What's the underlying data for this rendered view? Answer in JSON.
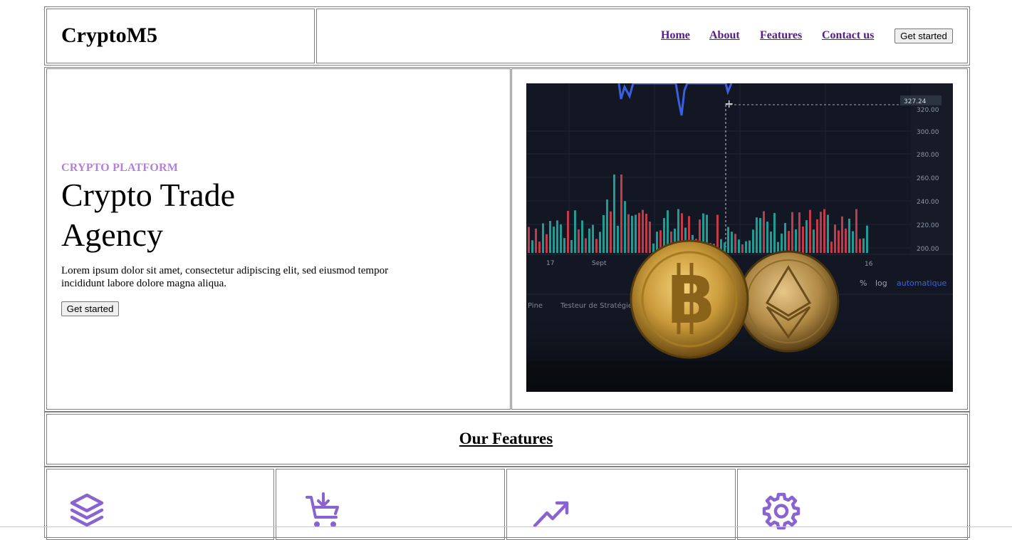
{
  "header": {
    "brand": "CryptoM5",
    "nav": [
      {
        "label": "Home"
      },
      {
        "label": "About"
      },
      {
        "label": "Features"
      },
      {
        "label": "Contact us"
      }
    ],
    "cta_label": "Get started"
  },
  "hero": {
    "eyebrow": "CRYPTO PLATFORM",
    "title": "Crypto Trade Agency",
    "description": "Lorem ipsum dolor sit amet, consectetur adipiscing elit, sed eiusmod tempor incididunt labore dolore magna aliqua.",
    "cta_label": "Get started",
    "image": {
      "price_ticks": [
        "320.00",
        "300.00",
        "280.00",
        "260.00",
        "240.00",
        "220.00",
        "200.00"
      ],
      "price_marker": "327.24",
      "date_labels": [
        "17",
        "Sept",
        "16"
      ],
      "controls": [
        "%",
        "log",
        "automatique"
      ],
      "panel_tabs": [
        "Pine",
        "Testeur de Stratégie"
      ]
    }
  },
  "features": {
    "title": "Our Features",
    "items": [
      {
        "icon": "layers-icon"
      },
      {
        "icon": "cart-download-icon"
      },
      {
        "icon": "trend-up-icon"
      },
      {
        "icon": "gear-icon"
      }
    ],
    "icon_color": "#8a63d2"
  },
  "colors": {
    "eyebrow": "#b57edc",
    "nav_link": "#551a8b"
  }
}
